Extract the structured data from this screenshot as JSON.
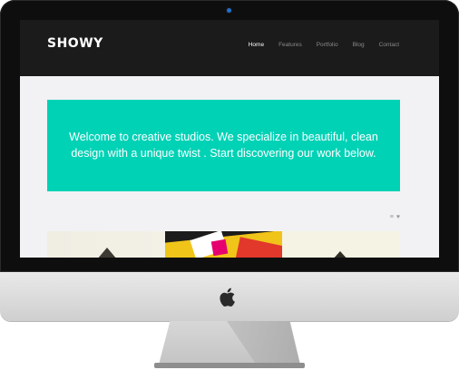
{
  "site": {
    "logo": "SHOWY",
    "nav": [
      "Home",
      "Features",
      "Portfolio",
      "Blog",
      "Contact"
    ],
    "active_nav": "Home"
  },
  "hero": {
    "text": "Welcome to creative studios. We specialize in beautiful, clean design with a unique twist . Start discovering our work below.",
    "background": "#00d2b6"
  },
  "toolbar": {
    "icons": [
      "list-icon",
      "heart-icon"
    ],
    "glyphs": [
      "≡",
      "♥"
    ]
  },
  "colors": {
    "header_bg": "#1b1b1b",
    "page_bg": "#f2f2f4",
    "accent": "#00d2b6",
    "camera": "#1e6fd0"
  }
}
